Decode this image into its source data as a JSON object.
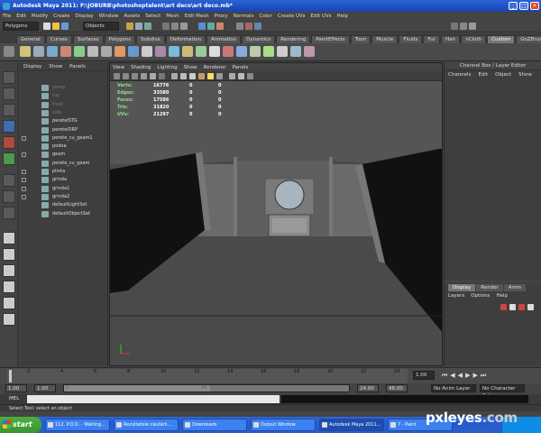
{
  "window": {
    "title": "Autodesk Maya 2011: F:\\JOBURB\\photoshoptalent\\art deco\\art deco.mb*",
    "controls": [
      "_",
      "□",
      "✕"
    ]
  },
  "menubar": [
    "File",
    "Edit",
    "Modify",
    "Create",
    "Display",
    "Window",
    "Assets",
    "Select",
    "Mesh",
    "Edit Mesh",
    "Proxy",
    "Normals",
    "Color",
    "Create UVs",
    "Edit UVs",
    "Help"
  ],
  "statusline": {
    "menu_set": "Polygons",
    "selection_mode": "Objects"
  },
  "shelf_tabs": [
    "General",
    "Curves",
    "Surfaces",
    "Polygons",
    "Subdivs",
    "Deformation",
    "Animation",
    "Dynamics",
    "Rendering",
    "PaintEffects",
    "Toon",
    "Muscle",
    "Fluids",
    "Fur",
    "Hair",
    "nCloth",
    "Custom",
    "GoZBrush"
  ],
  "shelf_active_tab": "Custom",
  "outliner": {
    "menu": [
      "Display",
      "Show",
      "Panels"
    ],
    "items": [
      {
        "label": "persp",
        "dim": true,
        "expand": false
      },
      {
        "label": "top",
        "dim": true,
        "expand": false
      },
      {
        "label": "front",
        "dim": true,
        "expand": false
      },
      {
        "label": "side",
        "dim": true,
        "expand": false
      },
      {
        "label": "peretelSTG",
        "dim": false,
        "expand": false
      },
      {
        "label": "peretelDRP",
        "dim": false,
        "expand": false
      },
      {
        "label": "perete_cu_geam1",
        "dim": false,
        "expand": true
      },
      {
        "label": "podea",
        "dim": false,
        "expand": false
      },
      {
        "label": "geam",
        "dim": false,
        "expand": true
      },
      {
        "label": "perete_cu_geam",
        "dim": false,
        "expand": false
      },
      {
        "label": "plinta",
        "dim": false,
        "expand": true
      },
      {
        "label": "grinda",
        "dim": false,
        "expand": true
      },
      {
        "label": "grinda1",
        "dim": false,
        "expand": true
      },
      {
        "label": "grinda2",
        "dim": false,
        "expand": true
      },
      {
        "label": "defaultLightSet",
        "dim": false,
        "expand": false
      },
      {
        "label": "defaultObjectSet",
        "dim": false,
        "expand": false
      }
    ]
  },
  "viewport": {
    "menu": [
      "View",
      "Shading",
      "Lighting",
      "Show",
      "Renderer",
      "Panels"
    ],
    "hud": [
      {
        "label": "Verts:",
        "v1": "16776",
        "v2": "0",
        "v3": "0"
      },
      {
        "label": "Edges:",
        "v1": "33580",
        "v2": "0",
        "v3": "0"
      },
      {
        "label": "Faces:",
        "v1": "17586",
        "v2": "0",
        "v3": "0"
      },
      {
        "label": "Tris:",
        "v1": "31820",
        "v2": "0",
        "v3": "0"
      },
      {
        "label": "UVs:",
        "v1": "21297",
        "v2": "0",
        "v3": "0"
      }
    ]
  },
  "channelbox": {
    "title": "Channel Box / Layer Editor",
    "menu": [
      "Channels",
      "Edit",
      "Object",
      "Show"
    ]
  },
  "layereditor": {
    "tabs": [
      "Display",
      "Render",
      "Anim"
    ],
    "active_tab": "Display",
    "menu": [
      "Layers",
      "Options",
      "Help"
    ]
  },
  "timeslider": {
    "ticks": [
      "2",
      "4",
      "6",
      "8",
      "10",
      "12",
      "14",
      "16",
      "18",
      "20",
      "22",
      "24"
    ],
    "current_frame": "1.00"
  },
  "rangeslider": {
    "start": "1.00",
    "start_inner": "1.00",
    "range_start_mark": "1",
    "range_end_mark": "24",
    "end_inner": "24.00",
    "end": "48.00",
    "anim_layer": "No Anim Layer",
    "char_set": "No Character Set"
  },
  "cmdline": {
    "label": "MEL"
  },
  "helpline": {
    "text": "Select Tool: select an object"
  },
  "taskbar": {
    "start": "start",
    "tasks": [
      {
        "label": "112. P.O.D. - Waiting...",
        "active": false
      },
      {
        "label": "Rezultatele căutării...",
        "active": false
      },
      {
        "label": "Downloads",
        "active": false
      },
      {
        "label": "Output Window",
        "active": false
      },
      {
        "label": "Autodesk Maya 2011...",
        "active": true
      },
      {
        "label": "7 - Paint",
        "active": false
      }
    ]
  },
  "watermark": {
    "brand": "pxleyes",
    "suffix": ".com"
  },
  "colors": {
    "xp_blue": "#245ccd",
    "start_green": "#3a9530",
    "maya_gray": "#444444",
    "hud_green": "#8fdc8f"
  }
}
